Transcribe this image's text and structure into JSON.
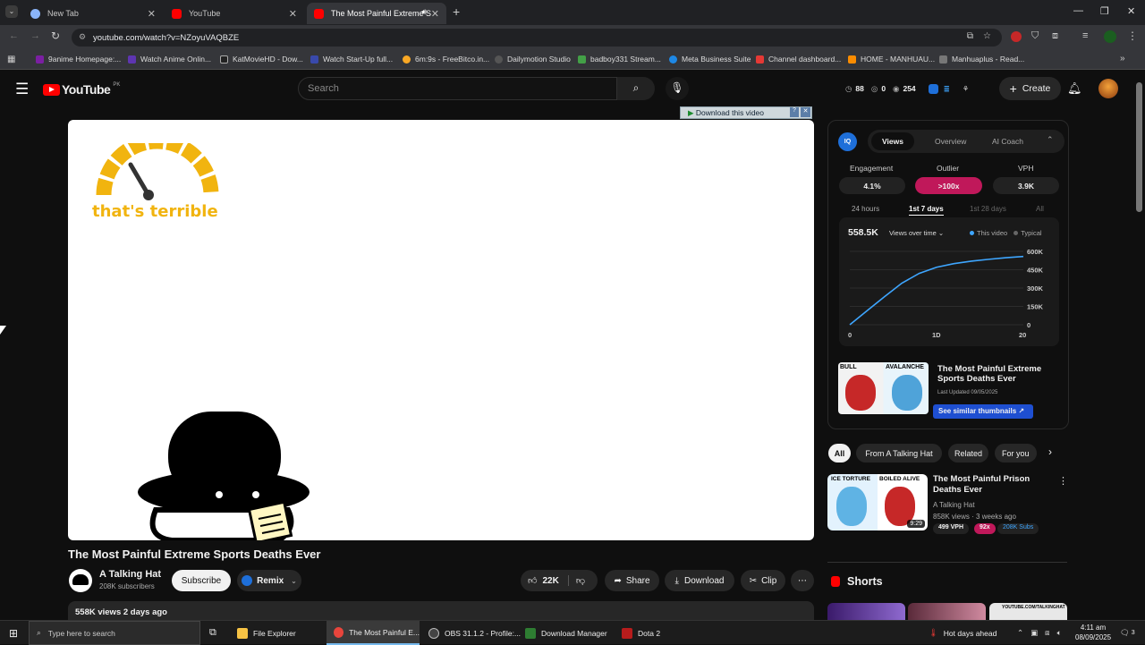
{
  "browser": {
    "tabs": [
      {
        "label": "New Tab"
      },
      {
        "label": "YouTube"
      },
      {
        "label": "The Most Painful Extreme S"
      }
    ],
    "url": "youtube.com/watch?v=NZoyuVAQBZE",
    "bookmarks": [
      "9anime Homepage:...",
      "Watch Anime Onlin...",
      "KatMovieHD - Dow...",
      "Watch Start-Up full...",
      "6m:9s - FreeBitco.in...",
      "Dailymotion Studio",
      "badboy331 Stream...",
      "Meta Business Suite",
      "Channel dashboard...",
      "HOME - MANHUAU...",
      "Manhuaplus - Read..."
    ]
  },
  "youtube": {
    "logo": "YouTube",
    "region": "PK",
    "search_placeholder": "Search",
    "stats": {
      "a": "88",
      "b": "0",
      "c": "254"
    },
    "create": "Create",
    "download_bar": "Download this video",
    "video": {
      "speedo_text": "that's terrible"
    },
    "title": "The Most Painful Extreme Sports Deaths Ever",
    "channel": "A Talking Hat",
    "subs": "208K subscribers",
    "subscribe": "Subscribe",
    "remix": "Remix",
    "likes": "22K",
    "share": "Share",
    "download": "Download",
    "clip": "Clip",
    "meta": "558K views  2 days ago"
  },
  "iq": {
    "tabs": [
      "Views",
      "Overview",
      "AI Coach"
    ],
    "metrics": [
      {
        "label": "Engagement",
        "value": "4.1%"
      },
      {
        "label": "Outlier",
        "value": ">100x"
      },
      {
        "label": "VPH",
        "value": "3.9K"
      }
    ],
    "ranges": [
      "24 hours",
      "1st 7 days",
      "1st 28 days",
      "All"
    ],
    "total": "558.5K",
    "dropdown": "Views over time",
    "legend": [
      "This video",
      "Typical"
    ],
    "thumb_title": "The Most Painful Extreme Sports Deaths Ever",
    "last_updated": "Last Updated 09/05/2025",
    "similar": "See similar thumbnails",
    "thumb_labels": [
      "BULL",
      "AVALANCHE"
    ]
  },
  "chart_data": {
    "type": "line",
    "x": [
      0,
      2,
      4,
      6,
      8,
      10,
      12,
      14,
      16,
      18,
      20
    ],
    "series": [
      {
        "values": [
          0,
          115000,
          230000,
          340000,
          420000,
          470000,
          500000,
          520000,
          535000,
          548000,
          558500
        ]
      }
    ],
    "x_ticks": [
      "0",
      "1D",
      "20"
    ],
    "y_ticks": [
      "600K",
      "450K",
      "300K",
      "150K",
      "0"
    ],
    "ylim": [
      0,
      600000
    ]
  },
  "filters": [
    "All",
    "From A Talking Hat",
    "Related",
    "For you"
  ],
  "recommended": {
    "title": "The Most Painful Prison Deaths Ever",
    "channel": "A Talking Hat",
    "meta": "858K views · 3 weeks ago",
    "duration": "9:29",
    "vph": "499 VPH",
    "outlier": "92x",
    "subs": "208K Subs",
    "thumb_labels": [
      "ICE TORTURE",
      "BOILED ALIVE"
    ]
  },
  "shorts": {
    "title": "Shorts",
    "thumb3": "YOUTUBE.COM/TALKINGHAT"
  },
  "taskbar": {
    "search": "Type here to search",
    "apps": [
      "File Explorer",
      "The Most Painful E...",
      "OBS 31.1.2 - Profile:...",
      "Download Manager",
      "Dota 2"
    ],
    "weather": "Hot days ahead",
    "time": "4:11 am",
    "date": "08/09/2025",
    "notif": "3"
  },
  "colors": {
    "accent": "#3ea6ff",
    "outlier": "#c0185a",
    "yt_red": "#ff0000",
    "speedo": "#f1b40f"
  }
}
